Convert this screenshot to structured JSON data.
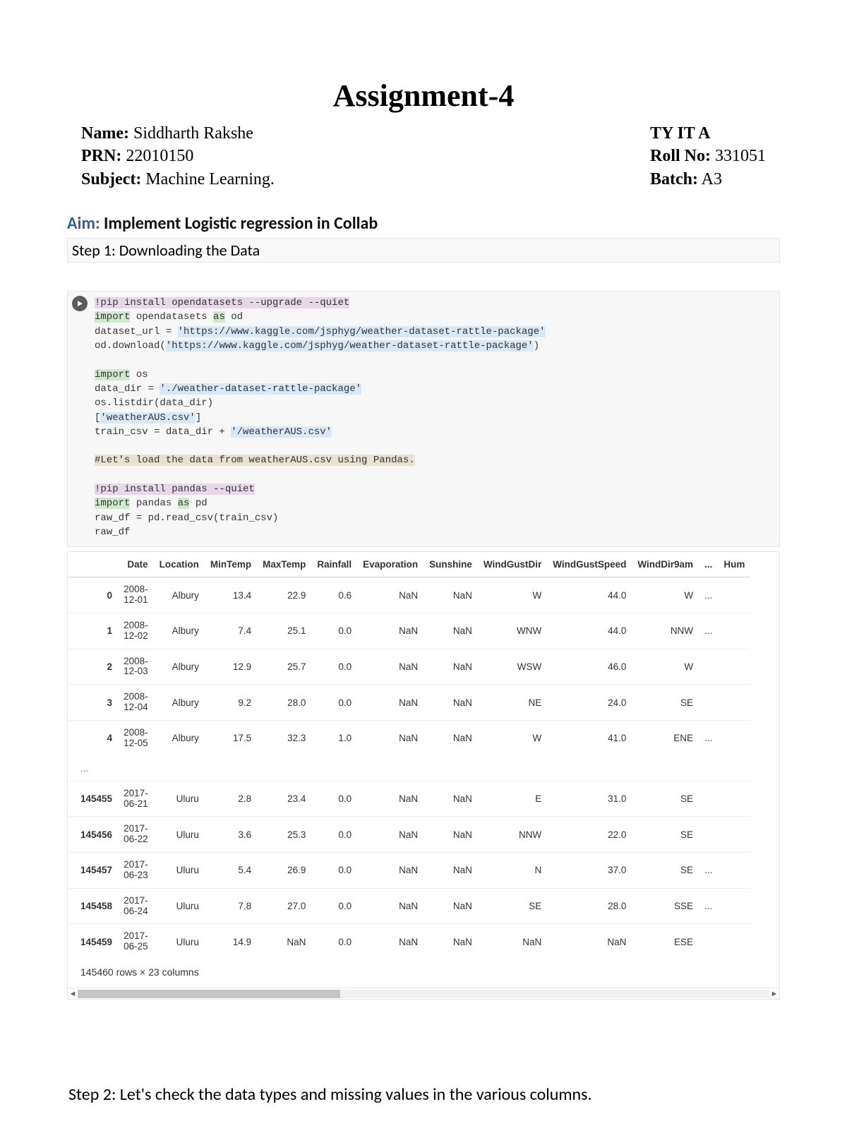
{
  "title": "Assignment-4",
  "info": {
    "left": [
      {
        "label": "Name:",
        "value": " Siddharth Rakshe"
      },
      {
        "label": "PRN:",
        "value": " 22010150"
      },
      {
        "label": "Subject:",
        "value": " Machine Learning."
      }
    ],
    "right": [
      {
        "label": "TY IT A",
        "value": ""
      },
      {
        "label": "Roll No:",
        "value": " 331051"
      },
      {
        "label": "Batch:",
        "value": " A3"
      }
    ]
  },
  "aim_label": "Aim: ",
  "aim_text": "Implement Logistic regression in Collab",
  "step1": "Step 1: Downloading the Data",
  "code": {
    "l1_a": "!pip install opendatasets --upgrade --quiet",
    "l2_a": "import",
    "l2_b": " opendatasets ",
    "l2_c": "as",
    "l2_d": " od",
    "l3_a": "dataset_url = ",
    "l3_b": "'https://www.kaggle.com/jsphyg/weather-dataset-rattle-package'",
    "l4_a": "od.download(",
    "l4_b": "'https://www.kaggle.com/jsphyg/weather-dataset-rattle-package'",
    "l4_c": ")",
    "l6_a": "import",
    "l6_b": " os",
    "l7_a": "data_dir = ",
    "l7_b": "'./weather-dataset-rattle-package'",
    "l8": "os.listdir(data_dir)",
    "l9_a": "[",
    "l9_b": "'weatherAUS.csv'",
    "l9_c": "]",
    "l10_a": "train_csv = data_dir + ",
    "l10_b": "'/weatherAUS.csv'",
    "l12": "#Let's load the data from weatherAUS.csv using Pandas.",
    "l14": "!pip install pandas --quiet",
    "l15_a": "import",
    "l15_b": " pandas ",
    "l15_c": "as",
    "l15_d": " pd",
    "l16": "raw_df = pd.read_csv(train_csv)",
    "l17": "raw_df"
  },
  "df": {
    "columns": [
      "",
      "Date",
      "Location",
      "MinTemp",
      "MaxTemp",
      "Rainfall",
      "Evaporation",
      "Sunshine",
      "WindGustDir",
      "WindGustSpeed",
      "WindDir9am",
      "...",
      "Hum"
    ],
    "rows": [
      {
        "idx": "0",
        "Date": [
          "2008-",
          "12-01"
        ],
        "Location": "Albury",
        "MinTemp": "13.4",
        "MaxTemp": "22.9",
        "Rainfall": "0.6",
        "Evaporation": "NaN",
        "Sunshine": "NaN",
        "WindGustDir": "W",
        "WindGustSpeed": "44.0",
        "WindDir9am": "W",
        "dots": "...",
        "Hum": ""
      },
      {
        "idx": "1",
        "Date": [
          "2008-",
          "12-02"
        ],
        "Location": "Albury",
        "MinTemp": "7.4",
        "MaxTemp": "25.1",
        "Rainfall": "0.0",
        "Evaporation": "NaN",
        "Sunshine": "NaN",
        "WindGustDir": "WNW",
        "WindGustSpeed": "44.0",
        "WindDir9am": "NNW",
        "dots": "...",
        "Hum": ""
      },
      {
        "idx": "2",
        "Date": [
          "2008-",
          "12-03"
        ],
        "Location": "Albury",
        "MinTemp": "12.9",
        "MaxTemp": "25.7",
        "Rainfall": "0.0",
        "Evaporation": "NaN",
        "Sunshine": "NaN",
        "WindGustDir": "WSW",
        "WindGustSpeed": "46.0",
        "WindDir9am": "W",
        "dots": "",
        "Hum": ""
      },
      {
        "idx": "3",
        "Date": [
          "2008-",
          "12-04"
        ],
        "Location": "Albury",
        "MinTemp": "9.2",
        "MaxTemp": "28.0",
        "Rainfall": "0.0",
        "Evaporation": "NaN",
        "Sunshine": "NaN",
        "WindGustDir": "NE",
        "WindGustSpeed": "24.0",
        "WindDir9am": "SE",
        "dots": "",
        "Hum": ""
      },
      {
        "idx": "4",
        "Date": [
          "2008-",
          "12-05"
        ],
        "Location": "Albury",
        "MinTemp": "17.5",
        "MaxTemp": "32.3",
        "Rainfall": "1.0",
        "Evaporation": "NaN",
        "Sunshine": "NaN",
        "WindGustDir": "W",
        "WindGustSpeed": "41.0",
        "WindDir9am": "ENE",
        "dots": "...",
        "Hum": ""
      }
    ],
    "rows2": [
      {
        "idx": "145455",
        "Date": [
          "2017-",
          "06-21"
        ],
        "Location": "Uluru",
        "MinTemp": "2.8",
        "MaxTemp": "23.4",
        "Rainfall": "0.0",
        "Evaporation": "NaN",
        "Sunshine": "NaN",
        "WindGustDir": "E",
        "WindGustSpeed": "31.0",
        "WindDir9am": "SE",
        "dots": "",
        "Hum": ""
      },
      {
        "idx": "145456",
        "Date": [
          "2017-",
          "06-22"
        ],
        "Location": "Uluru",
        "MinTemp": "3.6",
        "MaxTemp": "25.3",
        "Rainfall": "0.0",
        "Evaporation": "NaN",
        "Sunshine": "NaN",
        "WindGustDir": "NNW",
        "WindGustSpeed": "22.0",
        "WindDir9am": "SE",
        "dots": "",
        "Hum": ""
      },
      {
        "idx": "145457",
        "Date": [
          "2017-",
          "06-23"
        ],
        "Location": "Uluru",
        "MinTemp": "5.4",
        "MaxTemp": "26.9",
        "Rainfall": "0.0",
        "Evaporation": "NaN",
        "Sunshine": "NaN",
        "WindGustDir": "N",
        "WindGustSpeed": "37.0",
        "WindDir9am": "SE",
        "dots": "...",
        "Hum": ""
      },
      {
        "idx": "145458",
        "Date": [
          "2017-",
          "06-24"
        ],
        "Location": "Uluru",
        "MinTemp": "7.8",
        "MaxTemp": "27.0",
        "Rainfall": "0.0",
        "Evaporation": "NaN",
        "Sunshine": "NaN",
        "WindGustDir": "SE",
        "WindGustSpeed": "28.0",
        "WindDir9am": "SSE",
        "dots": "...",
        "Hum": ""
      },
      {
        "idx": "145459",
        "Date": [
          "2017-",
          "06-25"
        ],
        "Location": "Uluru",
        "MinTemp": "14.9",
        "MaxTemp": "NaN",
        "Rainfall": "0.0",
        "Evaporation": "NaN",
        "Sunshine": "NaN",
        "WindGustDir": "NaN",
        "WindGustSpeed": "NaN",
        "WindDir9am": "ESE",
        "dots": "",
        "Hum": ""
      }
    ],
    "ellipsis": "...",
    "footer": "145460 rows × 23 columns"
  },
  "step2": "Step 2: Let's check the data types and missing values in the various columns.",
  "scroll_arrows": {
    "left": "◄",
    "right": "►"
  }
}
